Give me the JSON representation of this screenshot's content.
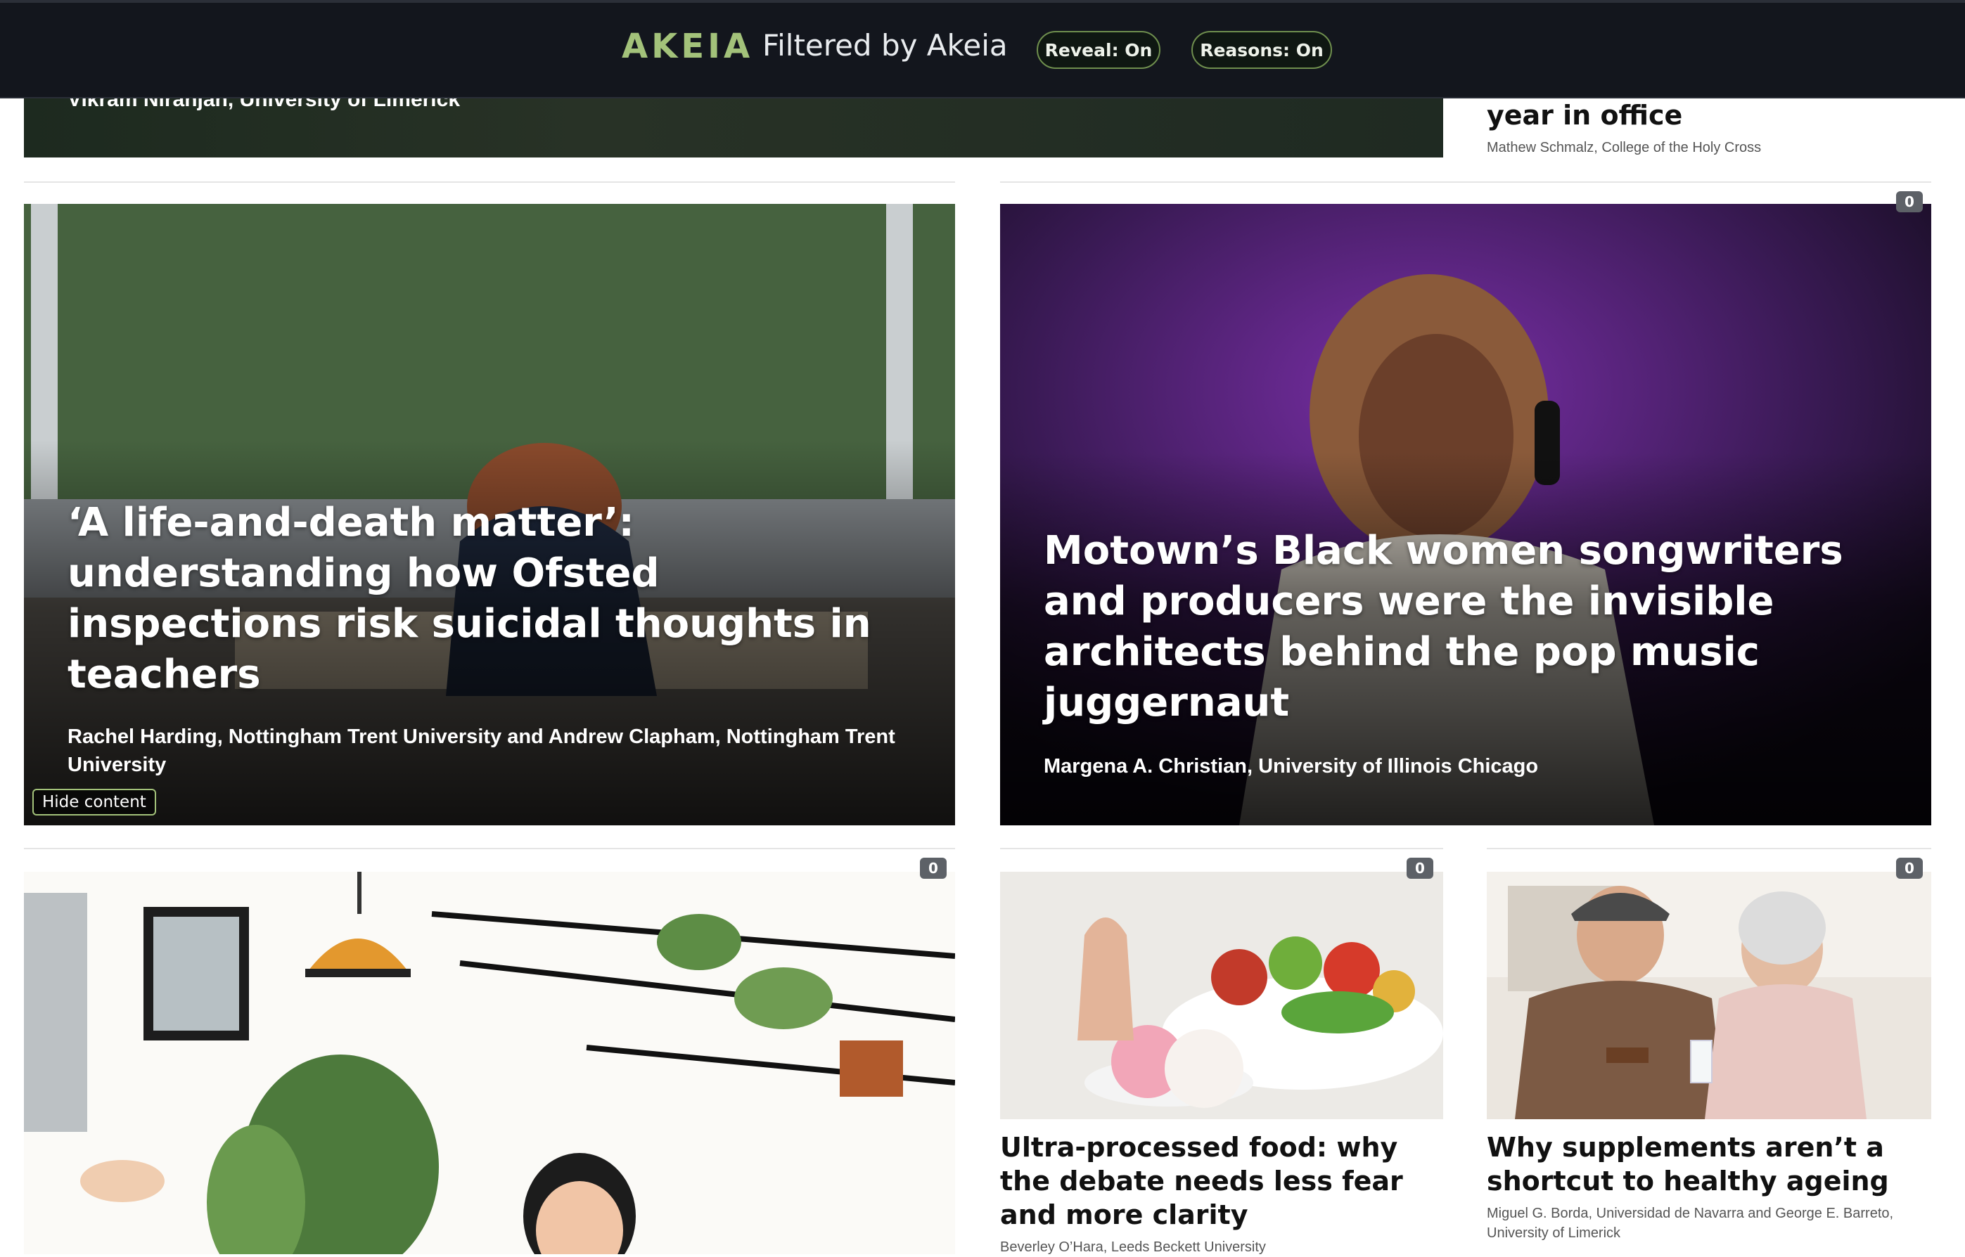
{
  "header": {
    "brand": "AKEIA",
    "subtitle": "Filtered by Akeia",
    "reveal_label": "Reveal: On",
    "reasons_label": "Reasons: On",
    "accent_color": "#a3c27a"
  },
  "top_partial": {
    "left_author": "Vikram Niranjan, University of Limerick",
    "right_title": "year in office",
    "right_author": "Mathew Schmalz, College of the Holy Cross"
  },
  "articles": [
    {
      "title": "‘A life-and-death matter’: understanding how Ofsted inspections risk suicidal thoughts in teachers",
      "author": "Rachel Harding, Nottingham Trent University and Andrew Clapham, Nottingham Trent University",
      "hide_label": "Hide content"
    },
    {
      "title": "Motown’s Black women songwriters and producers were the invisible architects behind the pop music juggernaut",
      "author": "Margena A. Christian, University of Illinois Chicago",
      "count": "0"
    },
    {
      "count": "0"
    },
    {
      "title": "Ultra-processed food: why the debate needs less fear and more clarity",
      "author": "Beverley O’Hara, Leeds Beckett University",
      "count": "0"
    },
    {
      "title": "Why supplements aren’t a shortcut to healthy ageing",
      "author": "Miguel G. Borda, Universidad de Navarra and George E. Barreto, University of Limerick",
      "count": "0"
    }
  ]
}
